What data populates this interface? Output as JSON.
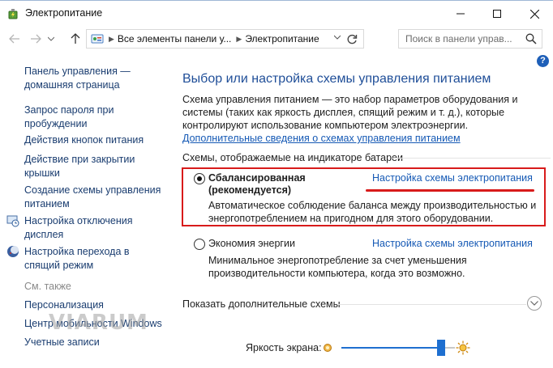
{
  "window": {
    "title": "Электропитание",
    "icons": {
      "app": "power-battery-icon",
      "minimize": "minimize-icon",
      "maximize": "maximize-icon",
      "close": "close-icon"
    }
  },
  "address_bar": {
    "crumbs": [
      "Все элементы панели у...",
      "Электропитание"
    ],
    "search_placeholder": "Поиск в панели управ...",
    "icons": {
      "back": "back-arrow-icon",
      "forward": "forward-arrow-icon",
      "recent": "chevron-down-icon",
      "up": "up-arrow-icon",
      "control_panel": "control-panel-icon",
      "refresh": "refresh-icon",
      "search": "search-icon"
    }
  },
  "help_label": "?",
  "sidebar": {
    "items": [
      {
        "label": "Панель управления — домашняя страница",
        "icon": null
      },
      {
        "label": "Запрос пароля при пробуждении",
        "icon": null
      },
      {
        "label": "Действия кнопок питания",
        "icon": null
      },
      {
        "label": "Действие при закрытии крышки",
        "icon": null
      },
      {
        "label": "Создание схемы управления питанием",
        "icon": null
      },
      {
        "label": "Настройка отключения дисплея",
        "icon": "display-clock-icon"
      },
      {
        "label": "Настройка перехода в спящий режим",
        "icon": "moon-sleep-icon"
      }
    ],
    "see_also_title": "См. также",
    "see_also": [
      {
        "label": "Персонализация"
      },
      {
        "label": "Центр мобильности Windows"
      },
      {
        "label": "Учетные записи"
      }
    ]
  },
  "main": {
    "title": "Выбор или настройка схемы управления питанием",
    "intro_text": "Схема управления питанием — это набор параметров оборудования и системы (таких как яркость дисплея, спящий режим и т. д.), которые контролируют использование компьютером электроэнергии.",
    "intro_link": "Дополнительные сведения о схемах управления питанием",
    "section_title": "Схемы, отображаемые на индикаторе батареи",
    "plans": [
      {
        "name": "Сбалансированная (рекомендуется)",
        "selected": true,
        "link": "Настройка схемы электропитания",
        "description": "Автоматическое соблюдение баланса между производительностью и энергопотреблением на пригодном для этого оборудовании."
      },
      {
        "name": "Экономия энергии",
        "selected": false,
        "link": "Настройка схемы электропитания",
        "description": "Минимальное энергопотребление за счет уменьшения производительности компьютера, когда это возможно."
      }
    ],
    "more_schemes": "Показать дополнительные схемы",
    "brightness": {
      "label": "Яркость экрана:",
      "value": 0.88,
      "icons": {
        "low": "brightness-low-icon",
        "high": "brightness-high-icon"
      }
    }
  },
  "colors": {
    "accent": "#1e6fd0",
    "link": "#1559b5",
    "title": "#1f4e98",
    "highlight": "#d81b1b"
  },
  "watermark": "VIARUM"
}
